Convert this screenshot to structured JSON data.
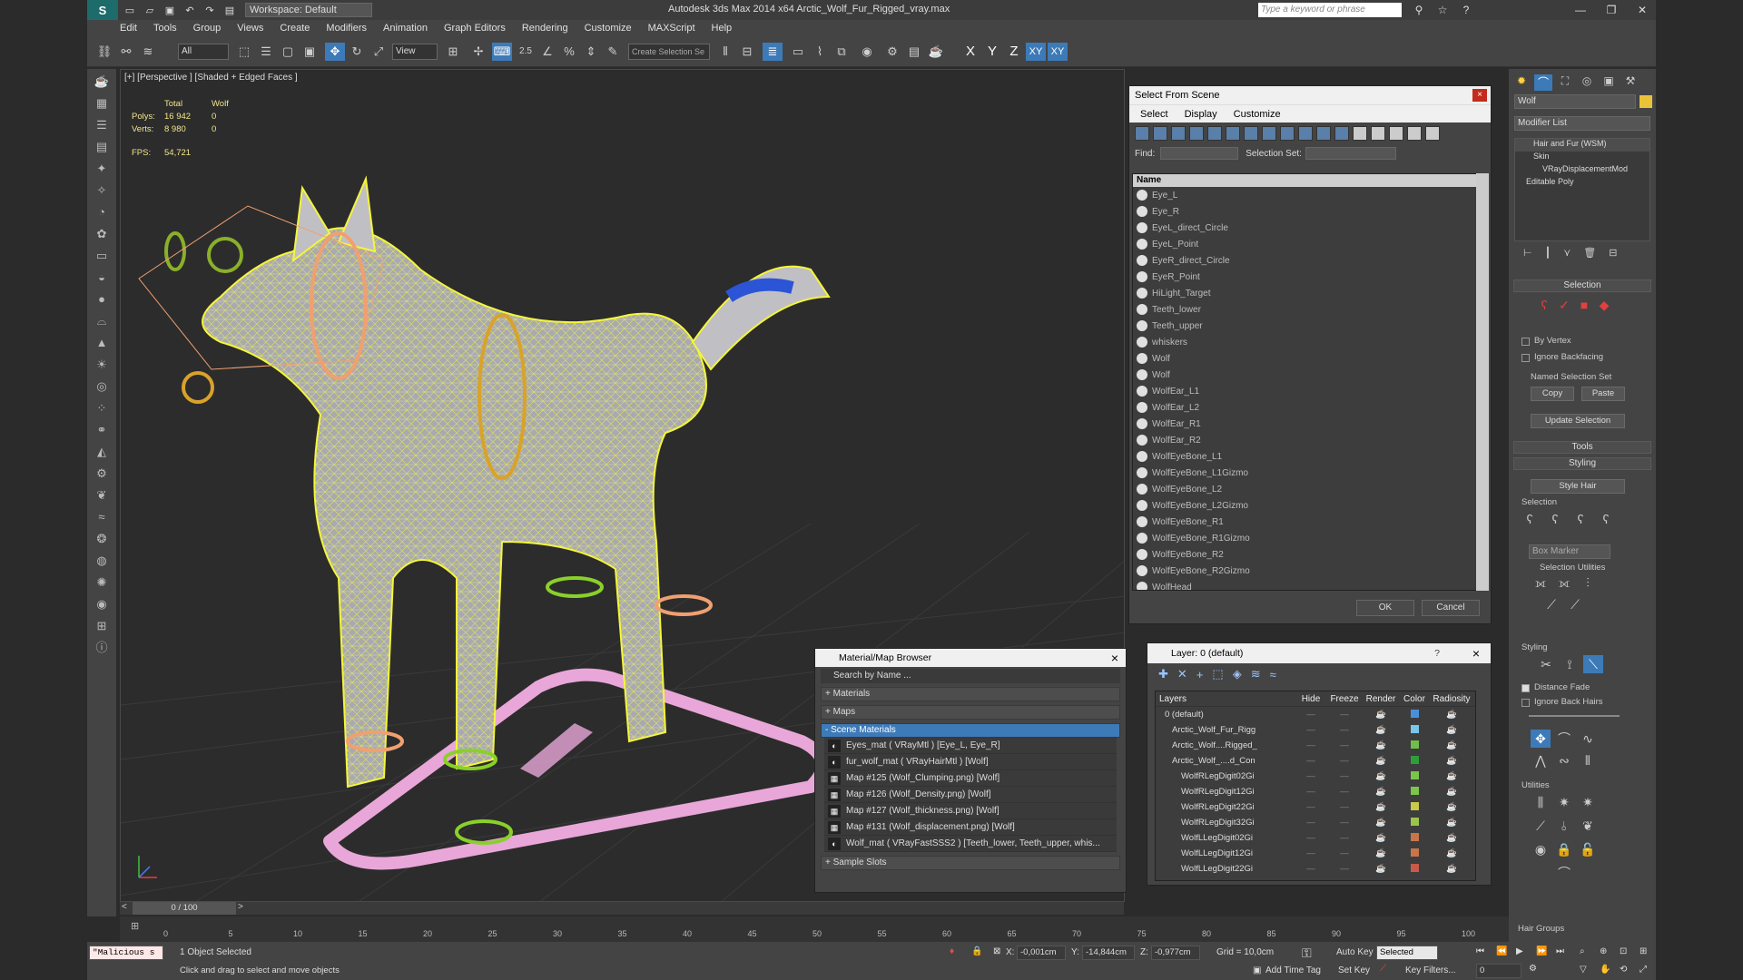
{
  "app": {
    "title": "Autodesk 3ds Max  2014 x64     Arctic_Wolf_Fur_Rigged_vray.max",
    "workspace": "Workspace: Default",
    "search_placeholder": "Type a keyword or phrase",
    "logo": "S"
  },
  "menu": [
    "Edit",
    "Tools",
    "Group",
    "Views",
    "Create",
    "Modifiers",
    "Animation",
    "Graph Editors",
    "Rendering",
    "Customize",
    "MAXScript",
    "Help"
  ],
  "toolbar": {
    "filter": "All",
    "ref_coord": "View",
    "snap_label": "2.5",
    "selection_set_placeholder": "Create Selection Se",
    "axes": [
      "X",
      "Y",
      "Z",
      "XY",
      "XY"
    ]
  },
  "viewport": {
    "label": "[+] [Perspective ] [Shaded + Edged Faces ]",
    "stats": {
      "col_total": "Total",
      "col_obj": "Wolf",
      "polys_label": "Polys:",
      "polys_total": "16 942",
      "polys_obj": "0",
      "verts_label": "Verts:",
      "verts_total": "8 980",
      "verts_obj": "0",
      "fps_label": "FPS:",
      "fps_value": "54,721"
    }
  },
  "select_from_scene": {
    "title": "Select From Scene",
    "close": "×",
    "menu": [
      "Select",
      "Display",
      "Customize"
    ],
    "find_label": "Find:",
    "selection_set_label": "Selection Set:",
    "col_name": "Name",
    "items": [
      "Eye_L",
      "Eye_R",
      "EyeL_direct_Circle",
      "EyeL_Point",
      "EyeR_direct_Circle",
      "EyeR_Point",
      "HiLight_Target",
      "Teeth_lower",
      "Teeth_upper",
      "whiskers",
      "Wolf",
      "Wolf",
      "WolfEar_L1",
      "WolfEar_L2",
      "WolfEar_R1",
      "WolfEar_R2",
      "WolfEyeBone_L1",
      "WolfEyeBone_L1Gizmo",
      "WolfEyeBone_L2",
      "WolfEyeBone_L2Gizmo",
      "WolfEyeBone_R1",
      "WolfEyeBone_R1Gizmo",
      "WolfEyeBone_R2",
      "WolfEyeBone_R2Gizmo",
      "WolfHead"
    ],
    "ok": "OK",
    "cancel": "Cancel"
  },
  "material_browser": {
    "title": "Material/Map Browser",
    "close": "×",
    "search": "Search by Name ...",
    "sections": {
      "materials": "+ Materials",
      "maps": "+ Maps",
      "scene": "- Scene Materials",
      "samples": "+ Sample Slots"
    },
    "scene_items": [
      {
        "icon": "◐",
        "label": "Eyes_mat  ( VRayMtl )  [Eye_L, Eye_R]"
      },
      {
        "icon": "◐",
        "label": "fur_wolf_mat  ( VRayHairMtl )  [Wolf]"
      },
      {
        "icon": "▦",
        "label": "Map #125 (Wolf_Clumping.png)  [Wolf]"
      },
      {
        "icon": "▦",
        "label": "Map #126 (Wolf_Density.png)  [Wolf]"
      },
      {
        "icon": "▦",
        "label": "Map #127 (Wolf_thickness.png)  [Wolf]"
      },
      {
        "icon": "▦",
        "label": "Map #131 (Wolf_displacement.png)  [Wolf]"
      },
      {
        "icon": "◐",
        "label": "Wolf_mat  ( VRayFastSSS2 )  [Teeth_lower, Teeth_upper, whis..."
      }
    ]
  },
  "layer": {
    "title": "Layer: 0 (default)",
    "question": "?",
    "close": "×",
    "columns": [
      "Layers",
      "Hide",
      "Freeze",
      "Render",
      "Color",
      "Radiosity"
    ],
    "rows": [
      {
        "name": "0 (default)",
        "color": "#4a90d9"
      },
      {
        "name": "Arctic_Wolf_Fur_Rigg",
        "color": "#7ac5e8"
      },
      {
        "name": "Arctic_Wolf....Rigged_",
        "color": "#6fbf4a"
      },
      {
        "name": "Arctic_Wolf_....d_Con",
        "color": "#2e9e3a"
      },
      {
        "name": "WolfRLegDigit02Gi",
        "color": "#7ac54a"
      },
      {
        "name": "WolfRLegDigit12Gi",
        "color": "#7ac54a"
      },
      {
        "name": "WolfRLegDigit22Gi",
        "color": "#c9c94a"
      },
      {
        "name": "WolfRLegDigit32Gi",
        "color": "#9ac54a"
      },
      {
        "name": "WolfLLegDigit02Gi",
        "color": "#c9754a"
      },
      {
        "name": "WolfLLegDigit12Gi",
        "color": "#c9754a"
      },
      {
        "name": "WolfLLegDigit22Gi",
        "color": "#c95a4a"
      }
    ]
  },
  "command_panel": {
    "object_name": "Wolf",
    "modifier_list": "Modifier List",
    "stack": [
      "Hair and Fur (WSM)",
      "Skin",
      "VRayDisplacementMod",
      "Editable Poly"
    ],
    "selection_rollout": "Selection",
    "by_vertex": "By Vertex",
    "ignore_backfacing": "Ignore Backfacing",
    "named_selection_set": "Named Selection Set",
    "copy": "Copy",
    "paste": "Paste",
    "update_selection": "Update Selection",
    "tools_rollout": "Tools",
    "styling_rollout": "Styling",
    "style_hair": "Style Hair",
    "selection_group": "Selection",
    "box_marker": "Box Marker",
    "selection_utilities": "Selection Utilities",
    "styling_group": "Styling",
    "distance_fade": "Distance Fade",
    "ignore_back_hairs": "Ignore Back Hairs",
    "utilities_group": "Utilities",
    "hair_groups": "Hair Groups"
  },
  "timeline": {
    "frame": "0 / 100",
    "ticks": [
      "0",
      "5",
      "10",
      "15",
      "20",
      "25",
      "30",
      "35",
      "40",
      "45",
      "50",
      "55",
      "60",
      "65",
      "70",
      "75",
      "80",
      "85",
      "90",
      "95",
      "100"
    ]
  },
  "status": {
    "maxscript": "\"Malicious s",
    "objects_selected": "1 Object Selected",
    "prompt": "Click and drag to select and move objects",
    "x_label": "X:",
    "x": "-0,001cm",
    "y_label": "Y:",
    "y": "-14,844cm",
    "z_label": "Z:",
    "z": "-0,977cm",
    "grid": "Grid = 10,0cm",
    "auto_key": "Auto Key",
    "selected": "Selected",
    "set_key": "Set Key",
    "key_filters": "Key Filters...",
    "add_time_tag": "Add Time Tag",
    "frame_field": "0"
  },
  "colors": {
    "wire": "#f5f53a",
    "rig": "#f0a070",
    "base": "#e8a7d8",
    "accent": "#3d7ab8"
  }
}
